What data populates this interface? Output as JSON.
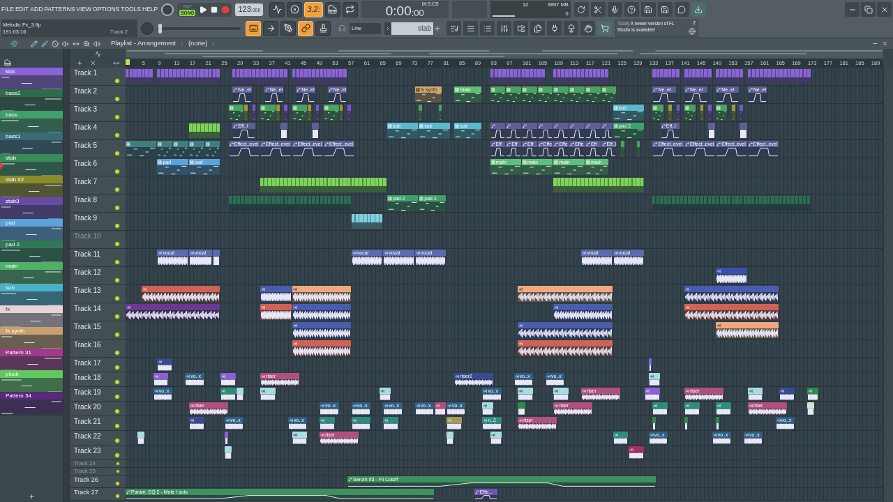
{
  "menu": [
    "FILE",
    "EDIT",
    "ADD",
    "PATTERNS",
    "VIEW",
    "OPTIONS",
    "TOOLS",
    "HELP"
  ],
  "project": {
    "file": "Melodic Fx_3.flp",
    "position": "191:03:16",
    "hint": "Track 2"
  },
  "modes": [
    {
      "label": "PAT",
      "selected": false
    },
    {
      "label": "SONG",
      "selected": true
    }
  ],
  "tempo": {
    "whole": "123",
    "fraction": ".000"
  },
  "toggles": [
    {
      "kind": "wave",
      "on": false
    },
    {
      "kind": "loop",
      "on": false
    },
    {
      "kind": "countdown",
      "label": "3.2:",
      "on": true
    },
    {
      "kind": "keys",
      "on": false
    },
    {
      "kind": "repeat",
      "on": false
    }
  ],
  "clock": {
    "time": "0:00",
    "sub": ":00",
    "unit": "M:S:CS"
  },
  "monitor": {
    "voices": "12",
    "memory": "3897 MB",
    "polyphony": "0"
  },
  "master_pitch": {
    "level": 0.02
  },
  "tools": [
    {
      "kind": "keyboard",
      "on": true
    },
    {
      "kind": "arrow",
      "on": false
    },
    {
      "kind": "pen",
      "on": false
    },
    {
      "kind": "link",
      "on": true
    },
    {
      "kind": "stamp",
      "on": false
    }
  ],
  "snap": "Line",
  "pattern": "stab",
  "news": {
    "when": "Today",
    "text": "A newer version of FL Studio is available!",
    "count": "2"
  },
  "playlist": {
    "title": "Playlist - Arrangement",
    "sequence": "(none)",
    "ruler": [
      "5",
      "9",
      "13",
      "17",
      "21",
      "25",
      "29",
      "33",
      "37",
      "41",
      "45",
      "49",
      "53",
      "57",
      "61",
      "65",
      "69",
      "73",
      "77",
      "81",
      "85",
      "89",
      "93",
      "97",
      "101",
      "105",
      "109",
      "113",
      "117",
      "121",
      "125",
      "129",
      "133",
      "137",
      "141",
      "145",
      "149",
      "153",
      "157",
      "161",
      "165",
      "169",
      "173",
      "177",
      "181",
      "185",
      "189"
    ]
  },
  "patterns": [
    {
      "name": "kick",
      "color": "#8b63d8",
      "selected": false
    },
    {
      "name": "bass2",
      "color": "#2f6a4a",
      "selected": false
    },
    {
      "name": "bass",
      "color": "#3fa06a",
      "selected": false
    },
    {
      "name": "bass1",
      "color": "#3a6a7a",
      "selected": false
    },
    {
      "name": "stab",
      "color": "#3a8a5a",
      "selected": true
    },
    {
      "name": "stab #2",
      "color": "#8a8a2a",
      "selected": false
    },
    {
      "name": "stab3",
      "color": "#6a4aa8",
      "selected": false
    },
    {
      "name": "pad",
      "color": "#5aa2da",
      "selected": false
    },
    {
      "name": "pad 2",
      "color": "#2f7a55",
      "selected": false
    },
    {
      "name": "main",
      "color": "#4fb06a",
      "selected": false
    },
    {
      "name": "sub",
      "color": "#4ab0c8",
      "selected": false
    },
    {
      "name": "fx",
      "color": "#e6d2da",
      "selected": false
    },
    {
      "name": "fx synth",
      "color": "#c8a070",
      "selected": false
    },
    {
      "name": "Pattern 31",
      "color": "#a03a8a",
      "selected": false
    },
    {
      "name": "pluck",
      "color": "#5fc85f",
      "selected": false
    },
    {
      "name": "Pattern 34",
      "color": "#5a2a7a",
      "selected": false
    }
  ],
  "tracks": [
    {
      "name": "Track 1",
      "disabled": false,
      "clips": [
        {
          "kind": "block",
          "color": "#8b63d8"
        },
        {
          "kind": "block",
          "color": "#8b63d8"
        },
        {
          "kind": "block",
          "color": "#8b63d8"
        },
        {
          "kind": "block",
          "color": "#8b63d8"
        },
        {
          "kind": "block",
          "color": "#8b63d8"
        },
        {
          "kind": "block",
          "color": "#8b63d8"
        },
        {
          "kind": "block",
          "color": "#8b63d8"
        },
        {
          "kind": "block",
          "color": "#8b63d8"
        },
        {
          "kind": "block",
          "color": "#8b63d8"
        },
        {
          "kind": "block",
          "color": "#8b63d8"
        },
        {
          "kind": "block",
          "color": "#8b63d8"
        },
        {
          "kind": "block",
          "color": "#8b63d8"
        },
        {
          "kind": "block",
          "color": "#8b63d8"
        },
        {
          "kind": "block",
          "color": "#8b63d8"
        }
      ]
    },
    {
      "name": "Track 2",
      "disabled": false,
      "clips": [
        {
          "kind": "automation",
          "color": "#5d5f96",
          "label": "Ne..el"
        },
        {
          "kind": "automation",
          "color": "#5d5f96",
          "label": "Ne..el"
        },
        {
          "kind": "automation",
          "color": "#5d5f96",
          "label": "Ne..el"
        },
        {
          "kind": "automation",
          "color": "#5d5f96",
          "label": "Ne..el"
        },
        {
          "kind": "pattern",
          "color": "#d8a66c",
          "label": "fx synth"
        },
        {
          "kind": "pattern",
          "color": "#5fbf74",
          "label": "main"
        },
        {
          "kind": "pattern",
          "color": "#49a35f"
        },
        {
          "kind": "pattern",
          "color": "#49a35f"
        },
        {
          "kind": "pattern",
          "color": "#49a35f"
        },
        {
          "kind": "pattern",
          "color": "#49a35f"
        },
        {
          "kind": "pattern",
          "color": "#49a35f"
        },
        {
          "kind": "pattern",
          "color": "#49a35f"
        },
        {
          "kind": "pattern",
          "color": "#49a35f"
        },
        {
          "kind": "pattern",
          "color": "#49a35f"
        },
        {
          "kind": "automation",
          "color": "#5d5f96",
          "label": "Ne..el"
        },
        {
          "kind": "automation",
          "color": "#5d5f96",
          "label": "Ne..el"
        },
        {
          "kind": "automation",
          "color": "#5d5f96",
          "label": "Ne..el"
        },
        {
          "kind": "automation",
          "color": "#5d5f96",
          "label": "Ne..el"
        }
      ]
    },
    {
      "name": "Track 3",
      "disabled": false,
      "clips": [
        {
          "kind": "pattern",
          "color": "#49a35f"
        },
        {
          "kind": "pattern",
          "color": "#9a9a3a"
        },
        {
          "kind": "pattern",
          "color": "#7a55c8"
        },
        {
          "kind": "pattern",
          "color": "#49a35f"
        },
        {
          "kind": "pattern",
          "color": "#9a9a3a"
        },
        {
          "kind": "pattern",
          "color": "#7a55c8"
        },
        {
          "kind": "pattern",
          "color": "#49a35f"
        },
        {
          "kind": "pattern",
          "color": "#9a9a3a"
        },
        {
          "kind": "pattern",
          "color": "#7a55c8"
        },
        {
          "kind": "pattern",
          "color": "#49a35f"
        },
        {
          "kind": "pattern",
          "color": "#9a9a3a"
        },
        {
          "kind": "pattern",
          "color": "#7a55c8"
        },
        {
          "kind": "pattern",
          "color": "#49a35f"
        },
        {
          "kind": "pattern",
          "color": "#49a35f"
        },
        {
          "kind": "pattern",
          "color": "#58b8cc",
          "label": "sub"
        },
        {
          "kind": "pattern",
          "color": "#49a35f"
        },
        {
          "kind": "pattern",
          "color": "#9a9a3a"
        },
        {
          "kind": "pattern",
          "color": "#7a55c8"
        },
        {
          "kind": "pattern",
          "color": "#49a35f"
        },
        {
          "kind": "pattern",
          "color": "#9a9a3a"
        },
        {
          "kind": "pattern",
          "color": "#7a55c8"
        },
        {
          "kind": "pattern",
          "color": "#49a35f"
        },
        {
          "kind": "pattern",
          "color": "#9a9a3a"
        },
        {
          "kind": "pattern",
          "color": "#7a55c8"
        }
      ]
    },
    {
      "name": "Track 4",
      "disabled": false,
      "clips": [
        {
          "kind": "block",
          "color": "#7ed35a"
        },
        {
          "kind": "automation",
          "color": "#5d5f96",
          "label": "Eff..l"
        },
        {
          "kind": "audio",
          "color": "#5d5f96"
        },
        {
          "kind": "audio",
          "color": "#5d5f96"
        },
        {
          "kind": "pattern",
          "color": "#58b8cc",
          "label": "sub"
        },
        {
          "kind": "pattern",
          "color": "#58b8cc",
          "label": "sub"
        },
        {
          "kind": "pattern",
          "color": "#58b8cc",
          "label": "sub"
        },
        {
          "kind": "automation",
          "color": "#5d5f96"
        },
        {
          "kind": "automation",
          "color": "#5d5f96"
        },
        {
          "kind": "automation",
          "color": "#5d5f96"
        },
        {
          "kind": "automation",
          "color": "#5d5f96"
        },
        {
          "kind": "automation",
          "color": "#5d5f96"
        },
        {
          "kind": "automation",
          "color": "#5d5f96"
        },
        {
          "kind": "automation",
          "color": "#5d5f96"
        },
        {
          "kind": "automation",
          "color": "#5d5f96"
        },
        {
          "kind": "pattern",
          "color": "#3fa06a",
          "label": "pad 2"
        },
        {
          "kind": "automation",
          "color": "#5d5f96",
          "label": "Eff..l"
        },
        {
          "kind": "audio",
          "color": "#5d5f96"
        },
        {
          "kind": "audio",
          "color": "#5d5f96"
        }
      ]
    },
    {
      "name": "Track 5",
      "disabled": false,
      "clips": [
        {
          "kind": "pattern",
          "color": "#3d7f80"
        },
        {
          "kind": "pattern",
          "color": "#3d7f80"
        },
        {
          "kind": "pattern",
          "color": "#3d7f80"
        },
        {
          "kind": "pattern",
          "color": "#3d7f80"
        },
        {
          "kind": "pattern",
          "color": "#3d7f80"
        },
        {
          "kind": "automation",
          "color": "#5d5f96",
          "label": "Effect..evel"
        },
        {
          "kind": "automation",
          "color": "#5d5f96",
          "label": "Effect..evel"
        },
        {
          "kind": "automation",
          "color": "#5d5f96",
          "label": "Effect..evel"
        },
        {
          "kind": "automation",
          "color": "#5d5f96",
          "label": "Effect..evel"
        },
        {
          "kind": "automation",
          "color": "#5d5f96",
          "label": "Eff"
        },
        {
          "kind": "automation",
          "color": "#5d5f96",
          "label": "Eff"
        },
        {
          "kind": "automation",
          "color": "#5d5f96",
          "label": "Eff"
        },
        {
          "kind": "automation",
          "color": "#5d5f96",
          "label": "Effe"
        },
        {
          "kind": "automation",
          "color": "#5d5f96",
          "label": "Effe"
        },
        {
          "kind": "automation",
          "color": "#5d5f96",
          "label": "Effe"
        },
        {
          "kind": "automation",
          "color": "#5d5f96",
          "label": "Eff"
        },
        {
          "kind": "automation",
          "color": "#5d5f96",
          "label": "Eff..l"
        },
        {
          "kind": "pattern",
          "color": "#49a35f"
        },
        {
          "kind": "pattern",
          "color": "#49a35f"
        },
        {
          "kind": "automation",
          "color": "#5d5f96",
          "label": "Effect..evel"
        },
        {
          "kind": "automation",
          "color": "#5d5f96",
          "label": "Effect..evel"
        },
        {
          "kind": "automation",
          "color": "#5d5f96",
          "label": "Effect..evel"
        },
        {
          "kind": "automation",
          "color": "#5d5f96",
          "label": "Effect..evel"
        }
      ]
    },
    {
      "name": "Track 6",
      "disabled": false,
      "clips": [
        {
          "kind": "pattern",
          "color": "#5aa2da",
          "label": "pad"
        },
        {
          "kind": "pattern",
          "color": "#5aa2da",
          "label": "pad"
        },
        {
          "kind": "pattern",
          "color": "#5fbf74",
          "label": "main"
        },
        {
          "kind": "pattern",
          "color": "#5fbf74",
          "label": "main"
        },
        {
          "kind": "pattern",
          "color": "#5fbf74",
          "label": "main"
        },
        {
          "kind": "pattern",
          "color": "#5fbf74",
          "label": "main"
        }
      ]
    },
    {
      "name": "Track 7",
      "disabled": false,
      "clips": [
        {
          "kind": "block",
          "color": "#7ed35a"
        },
        {
          "kind": "block",
          "color": "#7ed35a"
        }
      ]
    },
    {
      "name": "Track 8",
      "disabled": false,
      "clips": [
        {
          "kind": "block",
          "color": "#2f6a55"
        },
        {
          "kind": "pattern",
          "color": "#3fa06a",
          "label": "pad 2"
        },
        {
          "kind": "pattern",
          "color": "#3fa06a",
          "label": "pad 2"
        },
        {
          "kind": "block",
          "color": "#2f6a55"
        }
      ]
    },
    {
      "name": "Track 9",
      "disabled": false,
      "clips": [
        {
          "kind": "block",
          "color": "#7ccfe0"
        }
      ]
    },
    {
      "name": "Track 10",
      "disabled": true
    },
    {
      "name": "Track 11",
      "disabled": false,
      "clips": [
        {
          "kind": "audio",
          "color": "#5a6aac",
          "label": "vocal"
        },
        {
          "kind": "audio",
          "color": "#5a6aac",
          "label": "vocal"
        },
        {
          "kind": "audio",
          "color": "#5a6aac"
        },
        {
          "kind": "audio",
          "color": "#5a6aac",
          "label": "vocal"
        },
        {
          "kind": "audio",
          "color": "#5a6aac",
          "label": "vocal"
        },
        {
          "kind": "audio",
          "color": "#5a6aac",
          "label": "vocal"
        },
        {
          "kind": "audio",
          "color": "#5a6aac",
          "label": "vocal"
        },
        {
          "kind": "audio",
          "color": "#5a6aac",
          "label": "vocal"
        }
      ]
    },
    {
      "name": "Track 12",
      "disabled": false,
      "clips": [
        {
          "kind": "audio",
          "color": "#3a4fa8"
        }
      ]
    },
    {
      "name": "Track 13",
      "disabled": false,
      "clips": [
        {
          "kind": "audio",
          "color": "#d06258"
        },
        {
          "kind": "audio",
          "color": "#4a5cae"
        },
        {
          "kind": "audio",
          "color": "#f0a880"
        },
        {
          "kind": "audio",
          "color": "#f0a880"
        },
        {
          "kind": "audio",
          "color": "#4a5cae"
        }
      ]
    },
    {
      "name": "Track 14",
      "disabled": false,
      "clips": [
        {
          "kind": "audio",
          "color": "#6a3a90"
        },
        {
          "kind": "audio",
          "color": "#d06258"
        },
        {
          "kind": "audio",
          "color": "#4a5cae"
        },
        {
          "kind": "audio",
          "color": "#4a5cae"
        },
        {
          "kind": "audio",
          "color": "#d06258"
        }
      ]
    },
    {
      "name": "Track 15",
      "disabled": false,
      "clips": [
        {
          "kind": "audio",
          "color": "#4a5cae"
        },
        {
          "kind": "audio",
          "color": "#4a5cae"
        },
        {
          "kind": "audio",
          "color": "#f0a880"
        }
      ]
    },
    {
      "name": "Track 16",
      "disabled": false,
      "clips": [
        {
          "kind": "audio",
          "color": "#d06258"
        },
        {
          "kind": "audio",
          "color": "#d06258"
        }
      ]
    },
    {
      "name": "Track 17",
      "disabled": false,
      "clips": [
        {
          "kind": "audio",
          "color": "#3a4a90"
        },
        {
          "kind": "audio",
          "color": "#8a60d8"
        }
      ]
    },
    {
      "name": "Track 18",
      "disabled": false,
      "clips": [
        {
          "kind": "audio",
          "color": "#8a60d8"
        },
        {
          "kind": "audio",
          "color": "#2f5f85",
          "label": "vo..x"
        },
        {
          "kind": "audio",
          "color": "#8a60d8"
        },
        {
          "kind": "audio",
          "color": "#b0507c",
          "label": "riser"
        },
        {
          "kind": "audio",
          "color": "#3a4a90",
          "label": "riser2"
        },
        {
          "kind": "audio",
          "color": "#2f5f85",
          "label": "vo..x"
        },
        {
          "kind": "audio",
          "color": "#2f5f85",
          "label": "vo..x"
        },
        {
          "kind": "audio",
          "color": "#a8dce4"
        }
      ]
    },
    {
      "name": "Track 19",
      "disabled": false,
      "clips": [
        {
          "kind": "audio",
          "color": "#2f5f85",
          "label": "vo..x"
        },
        {
          "kind": "audio",
          "color": "#2f8a70"
        },
        {
          "kind": "audio",
          "color": "#a8dce4"
        },
        {
          "kind": "audio",
          "color": "#a8dce4"
        },
        {
          "kind": "audio",
          "color": "#a8dce4"
        },
        {
          "kind": "audio",
          "color": "#2f5f85",
          "label": "vo..x"
        },
        {
          "kind": "audio",
          "color": "#a8dce4"
        },
        {
          "kind": "audio",
          "color": "#a8dce4"
        },
        {
          "kind": "audio",
          "color": "#b0507c",
          "label": "riser"
        },
        {
          "kind": "audio",
          "color": "#8a60d8"
        },
        {
          "kind": "audio",
          "color": "#b0507c",
          "label": "riser"
        },
        {
          "kind": "audio",
          "color": "#a8dce4"
        },
        {
          "kind": "audio",
          "color": "#3a4a90"
        },
        {
          "kind": "audio",
          "color": "#2f8a50"
        }
      ]
    },
    {
      "name": "Track 20",
      "disabled": false,
      "clips": [
        {
          "kind": "audio",
          "color": "#b0507c",
          "label": "riser"
        },
        {
          "kind": "audio",
          "color": "#2f5f85",
          "label": "vo..x"
        },
        {
          "kind": "audio",
          "color": "#2f5f85",
          "label": "vo..x"
        },
        {
          "kind": "audio",
          "color": "#2f5f85",
          "label": "vo..x"
        },
        {
          "kind": "audio",
          "color": "#2f5f85",
          "label": "vo..x"
        },
        {
          "kind": "audio",
          "color": "#b0507c"
        },
        {
          "kind": "audio",
          "color": "#2f5f85",
          "label": "vo..x"
        },
        {
          "kind": "audio",
          "color": "#a8dce4"
        },
        {
          "kind": "audio",
          "color": "#2f8a50"
        },
        {
          "kind": "audio",
          "color": "#b0507c",
          "label": "riser"
        },
        {
          "kind": "audio",
          "color": "#2f8a80"
        },
        {
          "kind": "audio",
          "color": "#2f8a80"
        },
        {
          "kind": "audio",
          "color": "#2f8a80"
        },
        {
          "kind": "audio",
          "color": "#b0507c",
          "label": "riser"
        },
        {
          "kind": "audio",
          "color": "#d0e8d0"
        }
      ]
    },
    {
      "name": "Track 21",
      "disabled": false,
      "clips": [
        {
          "kind": "audio",
          "color": "#3a4a90"
        },
        {
          "kind": "audio",
          "color": "#2f5f85",
          "label": "vo..x"
        },
        {
          "kind": "audio",
          "color": "#2f5f85",
          "label": "vo..x"
        },
        {
          "kind": "audio",
          "color": "#2f8a80"
        },
        {
          "kind": "audio",
          "color": "#2f8a80"
        },
        {
          "kind": "audio",
          "color": "#2f8a80"
        },
        {
          "kind": "audio",
          "color": "#a09a58"
        },
        {
          "kind": "audio",
          "color": "#2f8a80",
          "label": "n..2"
        },
        {
          "kind": "audio",
          "color": "#b0507c",
          "label": "riser"
        },
        {
          "kind": "audio",
          "color": "#2f8a50"
        },
        {
          "kind": "audio",
          "color": "#2f8a50"
        },
        {
          "kind": "audio",
          "color": "#2f8a50"
        },
        {
          "kind": "audio",
          "color": "#2f5f85",
          "label": "vo..x"
        }
      ]
    },
    {
      "name": "Track 22",
      "disabled": false,
      "clips": [
        {
          "kind": "audio",
          "color": "#a8dce4"
        },
        {
          "kind": "audio",
          "color": "#8a60d8"
        },
        {
          "kind": "audio",
          "color": "#a8dce4"
        },
        {
          "kind": "audio",
          "color": "#b0507c",
          "label": "riser"
        },
        {
          "kind": "audio",
          "color": "#a8dce4"
        },
        {
          "kind": "audio",
          "color": "#a8dce4"
        },
        {
          "kind": "audio",
          "color": "#2f8a80"
        },
        {
          "kind": "audio",
          "color": "#2f5f85",
          "label": "vo..x"
        },
        {
          "kind": "audio",
          "color": "#2f5f85",
          "label": "vo..x"
        },
        {
          "kind": "audio",
          "color": "#2f5f85",
          "label": "vo..x"
        }
      ]
    },
    {
      "name": "Track 23",
      "disabled": false,
      "clips": [
        {
          "kind": "audio",
          "color": "#a8dce4"
        },
        {
          "kind": "audio",
          "color": "#a0306a"
        }
      ]
    },
    {
      "name": "Track 24",
      "disabled": true
    },
    {
      "name": "Track 25",
      "disabled": true
    },
    {
      "name": "Track 26",
      "disabled": false,
      "clips": [
        {
          "kind": "automation",
          "color": "#3f8f5f",
          "label": "Serum #3 - Fil Cutoff"
        }
      ]
    },
    {
      "name": "Track 27",
      "disabled": false,
      "clips": [
        {
          "kind": "automation",
          "color": "#3f8f5f",
          "label": "Param. EQ 2 - Mute / solo"
        },
        {
          "kind": "automation",
          "color": "#6a55b0",
          "label": "Effe..."
        }
      ]
    }
  ]
}
